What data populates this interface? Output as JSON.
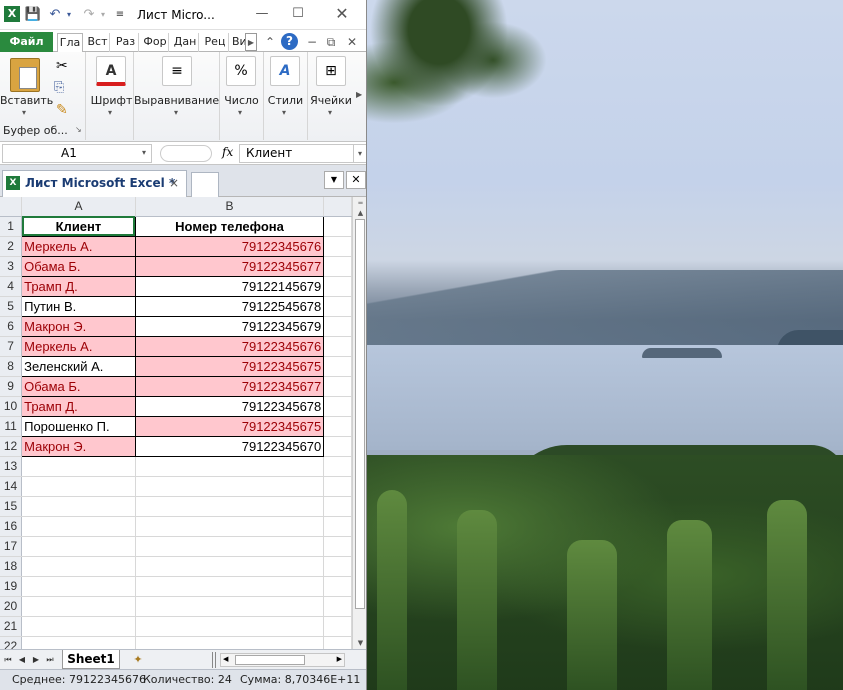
{
  "window": {
    "title": "Лист Micro...",
    "app_icon": "X",
    "quick_access": [
      "save-icon",
      "undo-icon",
      "redo-icon",
      "customize-icon"
    ],
    "controls": [
      "minimize-icon",
      "maximize-icon",
      "close-icon"
    ]
  },
  "ribbon_tabs": {
    "file": "Файл",
    "tabs": [
      "Гла",
      "Вст",
      "Раз",
      "Фор",
      "Дан",
      "Рец",
      "Ви"
    ]
  },
  "ribbon": {
    "paste": "Вставить",
    "clipboard": "Буфер об...",
    "font": "Шрифт",
    "alignment": "Выравнивание",
    "number": "Число",
    "styles": "Стили",
    "cells": "Ячейки",
    "number_symbol": "%",
    "font_symbol": "A"
  },
  "formula_bar": {
    "name_box": "A1",
    "fx": "fx",
    "value": "Клиент"
  },
  "document_tab": {
    "title": "Лист Microsoft Excel *",
    "close": "×"
  },
  "grid": {
    "columns": [
      "A",
      "B"
    ],
    "rows": [
      "1",
      "2",
      "3",
      "4",
      "5",
      "6",
      "7",
      "8",
      "9",
      "10",
      "11",
      "12",
      "13",
      "14",
      "15",
      "16",
      "17",
      "18",
      "19",
      "20",
      "21",
      "22"
    ],
    "header": {
      "a": "Клиент",
      "b": "Номер телефона"
    },
    "data": [
      {
        "a": "Меркель А.",
        "b": "79122345676",
        "a_dup": true,
        "b_dup": true
      },
      {
        "a": "Обама Б.",
        "b": "79122345677",
        "a_dup": true,
        "b_dup": true
      },
      {
        "a": "Трамп Д.",
        "b": "79122145679",
        "a_dup": true,
        "b_dup": false
      },
      {
        "a": "Путин В.",
        "b": "79122545678",
        "a_dup": false,
        "b_dup": false
      },
      {
        "a": "Макрон Э.",
        "b": "79122345679",
        "a_dup": true,
        "b_dup": false
      },
      {
        "a": "Меркель А.",
        "b": "79122345676",
        "a_dup": true,
        "b_dup": true
      },
      {
        "a": "Зеленский А.",
        "b": "79122345675",
        "a_dup": false,
        "b_dup": true
      },
      {
        "a": "Обама Б.",
        "b": "79122345677",
        "a_dup": true,
        "b_dup": true
      },
      {
        "a": "Трамп Д.",
        "b": "79122345678",
        "a_dup": true,
        "b_dup": false
      },
      {
        "a": "Порошенко П.",
        "b": "79122345675",
        "a_dup": false,
        "b_dup": true
      },
      {
        "a": "Макрон Э.",
        "b": "79122345670",
        "a_dup": true,
        "b_dup": false
      }
    ]
  },
  "sheets": {
    "active": "Sheet1"
  },
  "status": {
    "average": "Среднее: 79122345676",
    "count": "Количество: 24",
    "sum": "Сумма: 8,70346E+11"
  },
  "colors": {
    "duplicate_fill": "#ffc7ce",
    "duplicate_text": "#9c0006",
    "excel_green": "#1f7a3b"
  }
}
